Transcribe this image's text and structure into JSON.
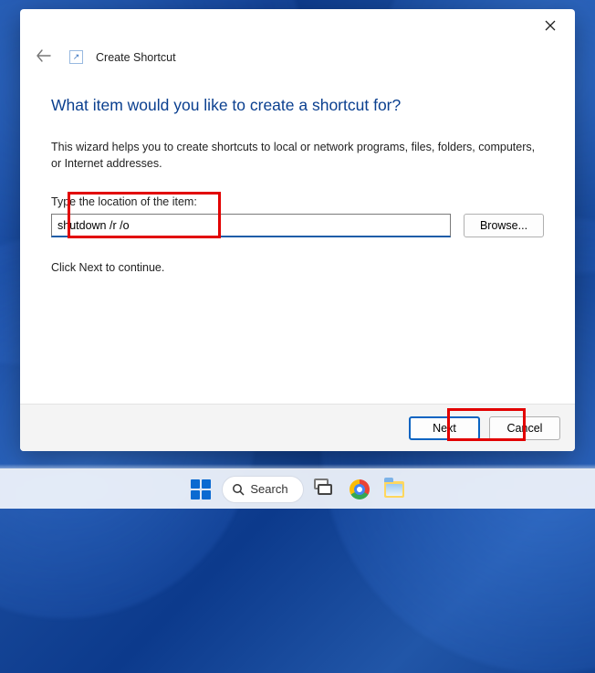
{
  "wizard": {
    "title": "Create Shortcut",
    "heading": "What item would you like to create a shortcut for?",
    "help": "This wizard helps you to create shortcuts to local or network programs, files, folders, computers, or Internet addresses.",
    "field_label": "Type the location of the item:",
    "location_value": "shutdown /r /o",
    "browse_label": "Browse...",
    "continue_hint": "Click Next to continue.",
    "next_label": "Next",
    "cancel_label": "Cancel"
  },
  "taskbar": {
    "search_label": "Search"
  }
}
